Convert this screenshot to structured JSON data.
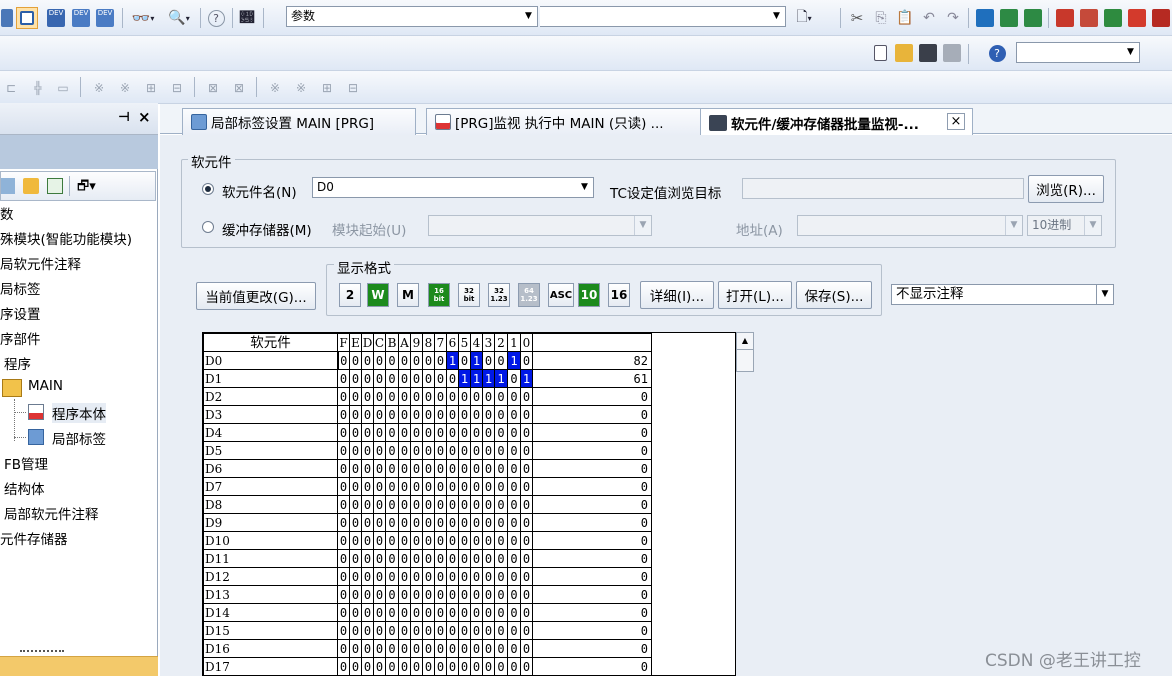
{
  "toolbar": {
    "search_combo_value": "参数",
    "dev_icon_label": "DEV"
  },
  "sidebar": {
    "pin_glyph": "⊣",
    "close_glyph": "×",
    "items": [
      {
        "label": "数"
      },
      {
        "label": "殊模块(智能功能模块)"
      },
      {
        "label": "局软元件注释"
      },
      {
        "label": "局标签"
      },
      {
        "label": "序设置"
      },
      {
        "label": "序部件"
      },
      {
        "label": "程序"
      },
      {
        "label": "MAIN"
      },
      {
        "label": "程序本体"
      },
      {
        "label": "局部标签"
      },
      {
        "label": "FB管理"
      },
      {
        "label": "结构体"
      },
      {
        "label": "局部软元件注释"
      },
      {
        "label": "元件存储器"
      }
    ]
  },
  "tabs": [
    {
      "label": "局部标签设置 MAIN [PRG]"
    },
    {
      "label": "[PRG]监视 执行中 MAIN (只读) ..."
    },
    {
      "label": "软元件/缓冲存储器批量监视-..."
    }
  ],
  "panel": {
    "group_device_title": "软元件",
    "radio_device_label": "软元件名(N)",
    "device_name_value": "D0",
    "tc_label": "TC设定值浏览目标",
    "browse_button": "浏览(R)...",
    "radio_buffer_label": "缓冲存储器(M)",
    "module_start_label": "模块起始(U)",
    "address_label": "地址(A)",
    "radix_value": "10进制",
    "display_format_title": "显示格式",
    "change_value_button": "当前值更改(G)...",
    "format_buttons": [
      "2",
      "W",
      "M",
      "16 bit",
      "32 bit",
      "32 1.23",
      "64 1.23",
      "ASC",
      "10",
      "16"
    ],
    "detail_button": "详细(I)...",
    "open_button": "打开(L)...",
    "save_button": "保存(S)...",
    "comment_combo_value": "不显示注释"
  },
  "grid": {
    "device_header": "软元件",
    "bit_headers": [
      "F",
      "E",
      "D",
      "C",
      "B",
      "A",
      "9",
      "8",
      "7",
      "6",
      "5",
      "4",
      "3",
      "2",
      "1",
      "0"
    ],
    "rows": [
      {
        "device": "D0",
        "bits": [
          0,
          0,
          0,
          0,
          0,
          0,
          0,
          0,
          0,
          1,
          0,
          1,
          0,
          0,
          1,
          0
        ],
        "value": "82"
      },
      {
        "device": "D1",
        "bits": [
          0,
          0,
          0,
          0,
          0,
          0,
          0,
          0,
          0,
          0,
          1,
          1,
          1,
          1,
          0,
          1
        ],
        "value": "61"
      },
      {
        "device": "D2",
        "bits": [
          0,
          0,
          0,
          0,
          0,
          0,
          0,
          0,
          0,
          0,
          0,
          0,
          0,
          0,
          0,
          0
        ],
        "value": "0"
      },
      {
        "device": "D3",
        "bits": [
          0,
          0,
          0,
          0,
          0,
          0,
          0,
          0,
          0,
          0,
          0,
          0,
          0,
          0,
          0,
          0
        ],
        "value": "0"
      },
      {
        "device": "D4",
        "bits": [
          0,
          0,
          0,
          0,
          0,
          0,
          0,
          0,
          0,
          0,
          0,
          0,
          0,
          0,
          0,
          0
        ],
        "value": "0"
      },
      {
        "device": "D5",
        "bits": [
          0,
          0,
          0,
          0,
          0,
          0,
          0,
          0,
          0,
          0,
          0,
          0,
          0,
          0,
          0,
          0
        ],
        "value": "0"
      },
      {
        "device": "D6",
        "bits": [
          0,
          0,
          0,
          0,
          0,
          0,
          0,
          0,
          0,
          0,
          0,
          0,
          0,
          0,
          0,
          0
        ],
        "value": "0"
      },
      {
        "device": "D7",
        "bits": [
          0,
          0,
          0,
          0,
          0,
          0,
          0,
          0,
          0,
          0,
          0,
          0,
          0,
          0,
          0,
          0
        ],
        "value": "0"
      },
      {
        "device": "D8",
        "bits": [
          0,
          0,
          0,
          0,
          0,
          0,
          0,
          0,
          0,
          0,
          0,
          0,
          0,
          0,
          0,
          0
        ],
        "value": "0"
      },
      {
        "device": "D9",
        "bits": [
          0,
          0,
          0,
          0,
          0,
          0,
          0,
          0,
          0,
          0,
          0,
          0,
          0,
          0,
          0,
          0
        ],
        "value": "0"
      },
      {
        "device": "D10",
        "bits": [
          0,
          0,
          0,
          0,
          0,
          0,
          0,
          0,
          0,
          0,
          0,
          0,
          0,
          0,
          0,
          0
        ],
        "value": "0"
      },
      {
        "device": "D11",
        "bits": [
          0,
          0,
          0,
          0,
          0,
          0,
          0,
          0,
          0,
          0,
          0,
          0,
          0,
          0,
          0,
          0
        ],
        "value": "0"
      },
      {
        "device": "D12",
        "bits": [
          0,
          0,
          0,
          0,
          0,
          0,
          0,
          0,
          0,
          0,
          0,
          0,
          0,
          0,
          0,
          0
        ],
        "value": "0"
      },
      {
        "device": "D13",
        "bits": [
          0,
          0,
          0,
          0,
          0,
          0,
          0,
          0,
          0,
          0,
          0,
          0,
          0,
          0,
          0,
          0
        ],
        "value": "0"
      },
      {
        "device": "D14",
        "bits": [
          0,
          0,
          0,
          0,
          0,
          0,
          0,
          0,
          0,
          0,
          0,
          0,
          0,
          0,
          0,
          0
        ],
        "value": "0"
      },
      {
        "device": "D15",
        "bits": [
          0,
          0,
          0,
          0,
          0,
          0,
          0,
          0,
          0,
          0,
          0,
          0,
          0,
          0,
          0,
          0
        ],
        "value": "0"
      },
      {
        "device": "D16",
        "bits": [
          0,
          0,
          0,
          0,
          0,
          0,
          0,
          0,
          0,
          0,
          0,
          0,
          0,
          0,
          0,
          0
        ],
        "value": "0"
      },
      {
        "device": "D17",
        "bits": [
          0,
          0,
          0,
          0,
          0,
          0,
          0,
          0,
          0,
          0,
          0,
          0,
          0,
          0,
          0,
          0
        ],
        "value": "0"
      }
    ]
  },
  "watermark": "CSDN @老王讲工控",
  "colors": {
    "bit_on": "#0018e6",
    "format_green": "#1c8a1c",
    "panel_bg": "#e9eef5"
  }
}
